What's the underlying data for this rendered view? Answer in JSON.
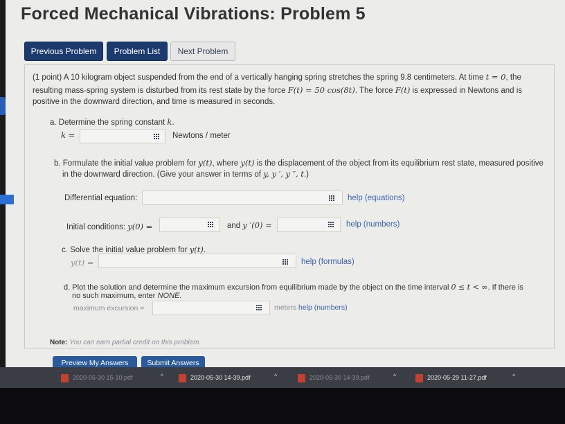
{
  "page_title": "Forced Mechanical Vibrations: Problem 5",
  "nav": {
    "previous": "Previous Problem",
    "list": "Problem List",
    "next": "Next Problem"
  },
  "problem": {
    "line1_a": "(1 point) A 10 kilogram object suspended from the end of a vertically hanging spring stretches the spring 9.8 centimeters. At time ",
    "line1_math_t": "t = 0",
    "line1_b": ", the",
    "line2_a": "resulting mass-spring system is disturbed from its rest state by the force ",
    "line2_math_f": "F(t) = 50 cos(8t)",
    "line2_b": ". The force ",
    "line2_math_f2": "F(t)",
    "line2_c": " is expressed in Newtons and is",
    "line3": "positive in the downward direction, and time is measured in seconds."
  },
  "part_a": {
    "label_a": "a. Determine the spring constant ",
    "label_math": "k",
    "label_b": ".",
    "var": "k =",
    "units": "Newtons / meter"
  },
  "part_b": {
    "line1_a": "b. Formulate the initial value problem for ",
    "line1_math": "y(t)",
    "line1_b": ", where ",
    "line1_math2": "y(t)",
    "line1_c": " is the displacement of the object from its equilibrium rest state, measured positive",
    "line2_a": "in the downward direction. (Give your answer in terms of ",
    "line2_math": "y, y ′, y ″, t",
    "line2_b": ".)",
    "de_label": "Differential equation:",
    "de_help": "help (equations)",
    "ic_label": "Initial conditions: ",
    "ic_math1": "y(0) =",
    "ic_and": "and ",
    "ic_math2": "y ′(0) =",
    "ic_help": "help (numbers)"
  },
  "part_c": {
    "label_a": "c. Solve the initial value problem for ",
    "label_math": "y(t)",
    "label_b": ".",
    "var": "y(t) =",
    "help": "help (formulas)"
  },
  "part_d": {
    "line1_a": "d. Plot the solution and determine the maximum excursion from equilibrium made by the object on the time interval ",
    "line1_math": "0 ≤ t < ∞",
    "line1_b": ". If there is",
    "line2_a": "no such maximum, enter ",
    "line2_none": "NONE",
    "line2_b": ".",
    "excursion_label": "maximum excursion =",
    "units": "meters",
    "help": "help (numbers)"
  },
  "note": {
    "bold": "Note:",
    "text": " You can earn partial credit on this problem."
  },
  "buttons": {
    "preview": "Preview My Answers",
    "submit": "Submit Answers"
  },
  "downloads": [
    {
      "name": "2020-05-30 15-10.pdf"
    },
    {
      "name": "2020-05-30 14-39.pdf"
    },
    {
      "name": "2020-05-30 14-39.pdf"
    },
    {
      "name": "2020-05-29 11-27.pdf"
    }
  ],
  "colors": {
    "nav_dark": "#1c3a6e",
    "link": "#3a63b8",
    "taskbar": "#3a3d44",
    "pdf_icon": "#c2412f"
  }
}
